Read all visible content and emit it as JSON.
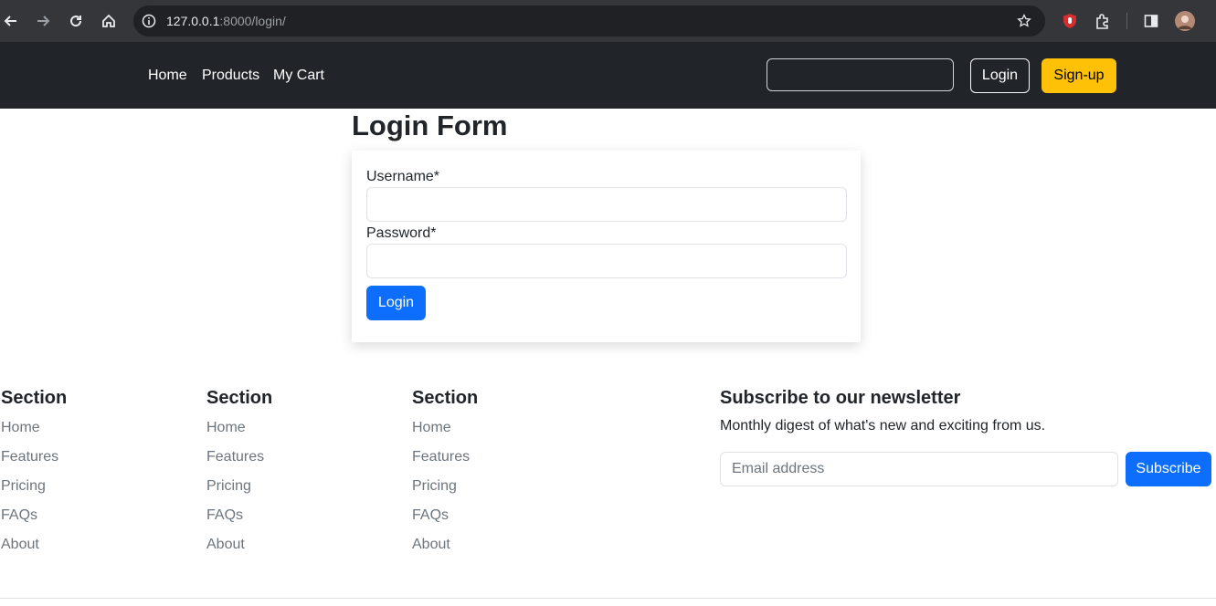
{
  "browser": {
    "url_host": "127.0.0.1",
    "url_path": ":8000/login/"
  },
  "navbar": {
    "links": [
      "Home",
      "Products",
      "My Cart"
    ],
    "search_value": "",
    "login_label": "Login",
    "signup_label": "Sign-up"
  },
  "login": {
    "title": "Login Form",
    "username_label": "Username*",
    "password_label": "Password*",
    "username_value": "",
    "password_value": "",
    "submit_label": "Login"
  },
  "footer": {
    "columns": [
      {
        "heading": "Section",
        "links": [
          "Home",
          "Features",
          "Pricing",
          "FAQs",
          "About"
        ]
      },
      {
        "heading": "Section",
        "links": [
          "Home",
          "Features",
          "Pricing",
          "FAQs",
          "About"
        ]
      },
      {
        "heading": "Section",
        "links": [
          "Home",
          "Features",
          "Pricing",
          "FAQs",
          "About"
        ]
      }
    ],
    "newsletter": {
      "heading": "Subscribe to our newsletter",
      "description": "Monthly digest of what's new and exciting from us.",
      "email_placeholder": "Email address",
      "button_label": "Subscribe"
    }
  },
  "colors": {
    "navbar_bg": "#212529",
    "primary": "#0d6efd",
    "warning": "#ffc107"
  },
  "icons": [
    "back-arrow-icon",
    "forward-arrow-icon",
    "reload-icon",
    "home-icon",
    "info-icon",
    "star-icon",
    "ublock-icon",
    "extensions-icon",
    "sidepanel-icon",
    "profile-avatar"
  ]
}
